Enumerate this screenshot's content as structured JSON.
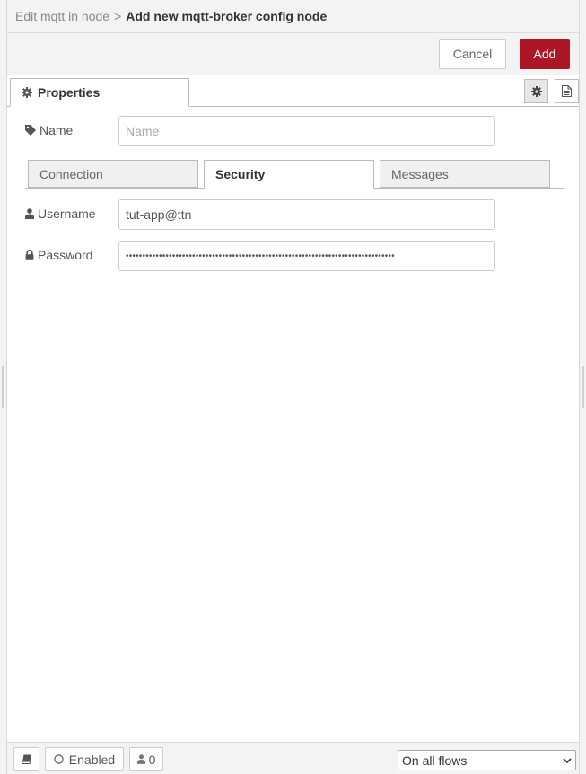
{
  "breadcrumb": {
    "parent": "Edit mqtt in node",
    "separator": ">",
    "current": "Add new mqtt-broker config node"
  },
  "toolbar": {
    "cancel_label": "Cancel",
    "add_label": "Add"
  },
  "tabs": {
    "properties_label": "Properties"
  },
  "form": {
    "name": {
      "label": "Name",
      "value": "",
      "placeholder": "Name"
    },
    "subtabs": [
      "Connection",
      "Security",
      "Messages"
    ],
    "active_subtab": "Security",
    "username": {
      "label": "Username",
      "value": "tut-app@ttn"
    },
    "password": {
      "label": "Password",
      "value": "•••••••••••••••••••••••••••••••••••••••••••••••••••••••••••••••••••••••••••••••••"
    }
  },
  "footer": {
    "enabled_label": "Enabled",
    "users_count": "0",
    "scope_selected": "On all flows"
  },
  "colors": {
    "accent_add": "#ad1625",
    "chrome_bg": "#f3f3f3"
  },
  "icons": {
    "properties_tab": "gear-icon",
    "settings_tab": "gear-icon",
    "info_tab": "document-icon",
    "name": "tag-icon",
    "username": "user-icon",
    "password": "lock-icon",
    "help": "book-icon",
    "enabled": "circle-icon",
    "users": "user-icon"
  }
}
